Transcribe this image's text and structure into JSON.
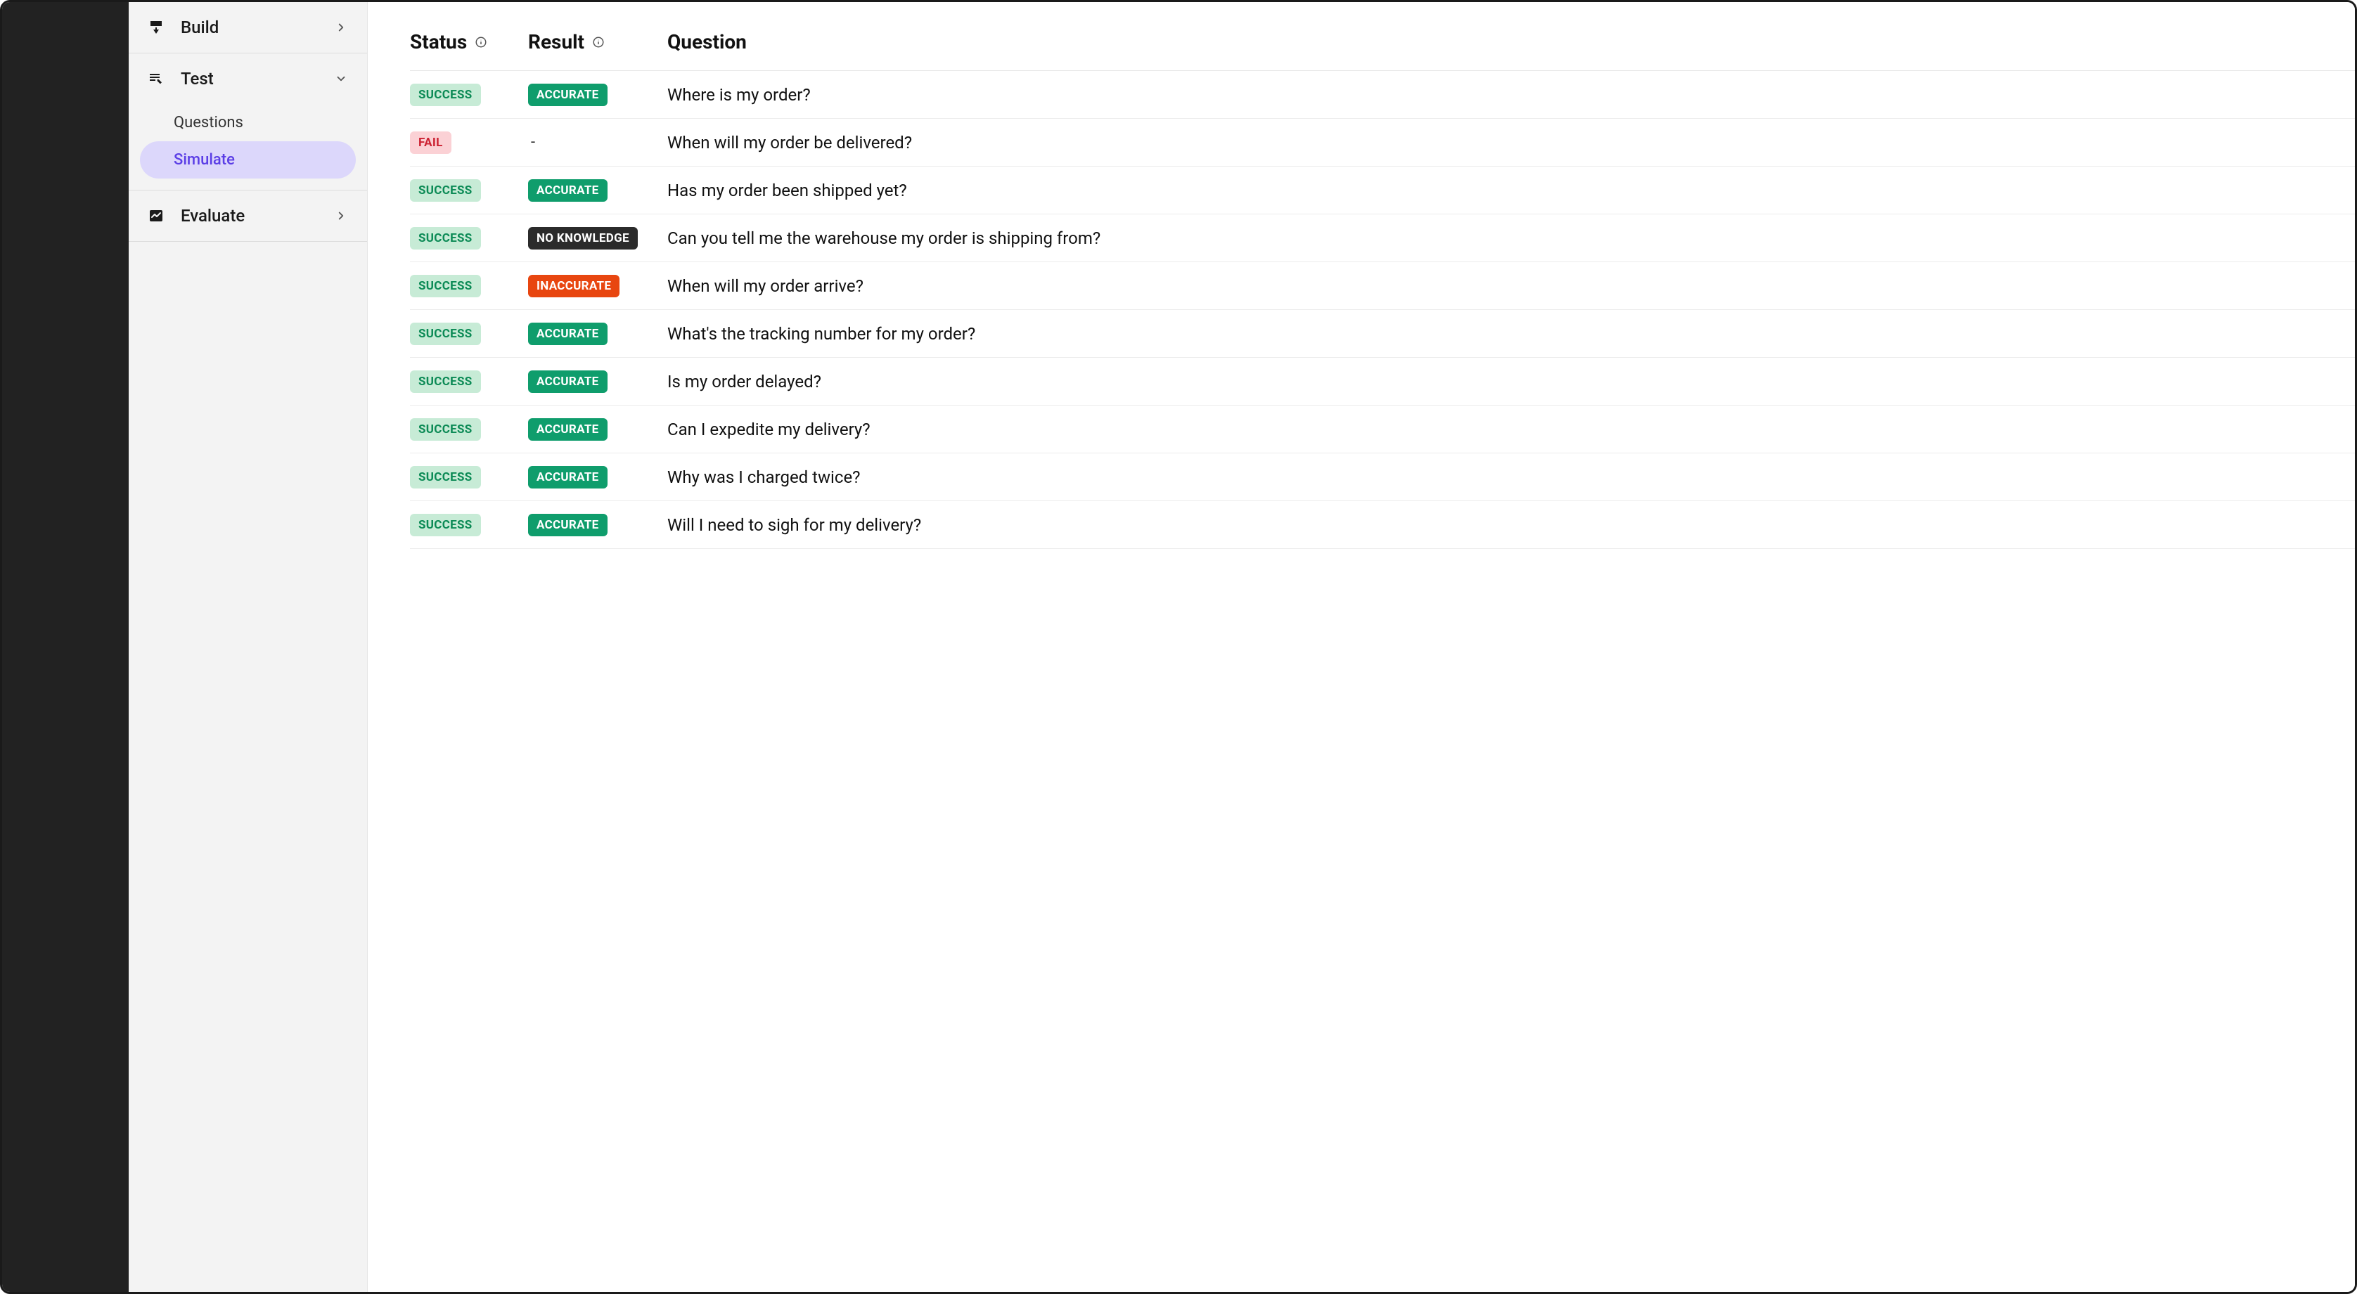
{
  "sidebar": {
    "build": {
      "label": "Build"
    },
    "test": {
      "label": "Test",
      "items": {
        "questions": {
          "label": "Questions"
        },
        "simulate": {
          "label": "Simulate"
        }
      }
    },
    "evaluate": {
      "label": "Evaluate"
    }
  },
  "headers": {
    "status": "Status",
    "result": "Result",
    "question": "Question"
  },
  "badges": {
    "SUCCESS": "SUCCESS",
    "FAIL": "FAIL",
    "ACCURATE": "ACCURATE",
    "INACCURATE": "INACCURATE",
    "NOKNOWLEDGE": "NO KNOWLEDGE",
    "DASH": "-"
  },
  "rows": [
    {
      "status": "SUCCESS",
      "result": "ACCURATE",
      "question": "Where is my order?"
    },
    {
      "status": "FAIL",
      "result": "DASH",
      "question": "When will my order be delivered?"
    },
    {
      "status": "SUCCESS",
      "result": "ACCURATE",
      "question": "Has my order been shipped yet?"
    },
    {
      "status": "SUCCESS",
      "result": "NOKNOWLEDGE",
      "question": "Can you tell me the warehouse my order is shipping from?"
    },
    {
      "status": "SUCCESS",
      "result": "INACCURATE",
      "question": "When will my order arrive?"
    },
    {
      "status": "SUCCESS",
      "result": "ACCURATE",
      "question": "What's the tracking number for my order?"
    },
    {
      "status": "SUCCESS",
      "result": "ACCURATE",
      "question": "Is my order delayed?"
    },
    {
      "status": "SUCCESS",
      "result": "ACCURATE",
      "question": "Can I expedite my delivery?"
    },
    {
      "status": "SUCCESS",
      "result": "ACCURATE",
      "question": "Why was I charged twice?"
    },
    {
      "status": "SUCCESS",
      "result": "ACCURATE",
      "question": "Will I need to sigh for my delivery?"
    }
  ]
}
